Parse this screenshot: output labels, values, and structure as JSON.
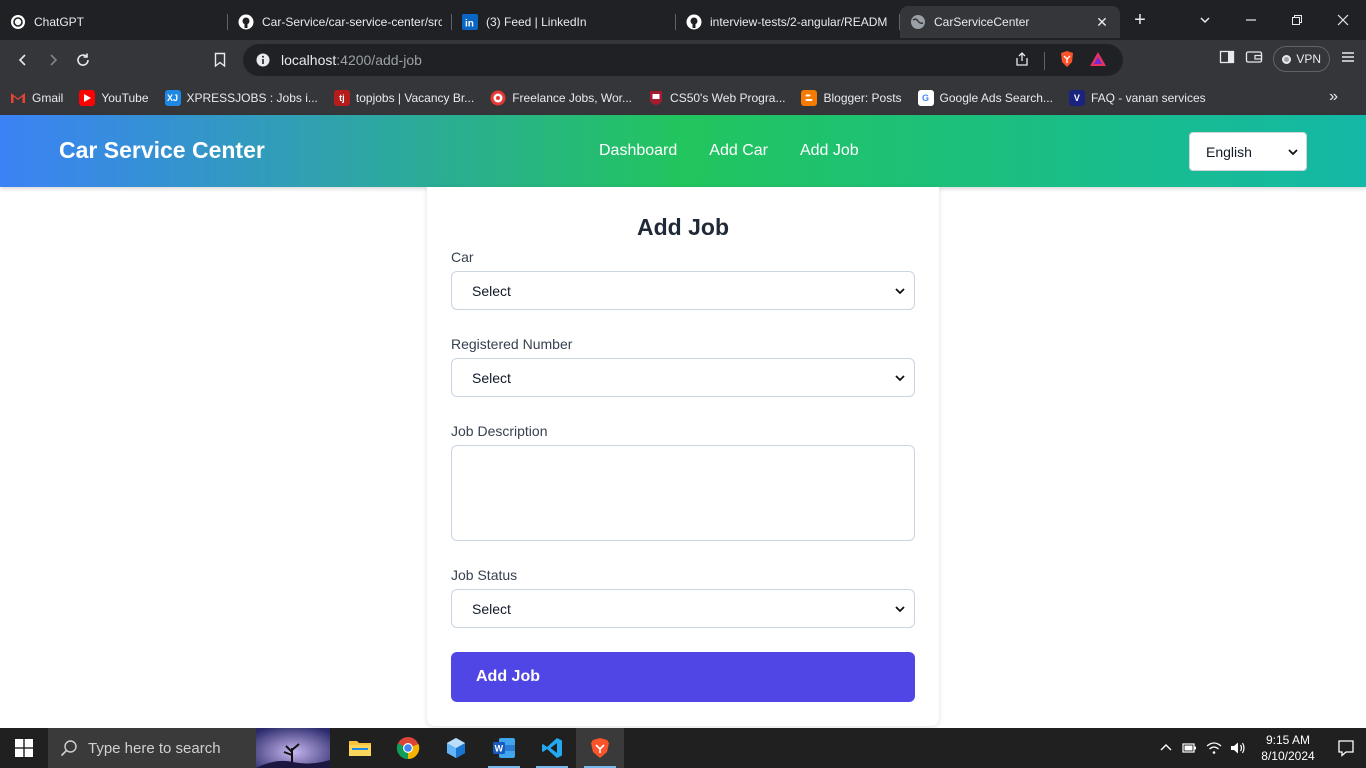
{
  "browser": {
    "tabs": [
      {
        "title": "ChatGPT",
        "icon": "openai-icon"
      },
      {
        "title": "Car-Service/car-service-center/src",
        "icon": "github-icon"
      },
      {
        "title": "(3) Feed | LinkedIn",
        "icon": "linkedin-icon"
      },
      {
        "title": "interview-tests/2-angular/READM",
        "icon": "github-icon"
      },
      {
        "title": "CarServiceCenter",
        "icon": "globe-icon",
        "active": true
      }
    ],
    "url_host": "localhost",
    "url_path": ":4200/add-job",
    "vpn_label": "VPN",
    "bookmarks": [
      {
        "label": "Gmail",
        "icon": "gmail-icon"
      },
      {
        "label": "YouTube",
        "icon": "youtube-icon"
      },
      {
        "label": "XPRESSJOBS : Jobs i...",
        "icon": "xj-icon",
        "icon_text": "XJ"
      },
      {
        "label": "topjobs | Vacancy Br...",
        "icon": "topjobs-icon",
        "icon_text": "tj"
      },
      {
        "label": "Freelance Jobs, Wor...",
        "icon": "freelance-icon"
      },
      {
        "label": "CS50's Web Progra...",
        "icon": "harvard-icon"
      },
      {
        "label": "Blogger: Posts",
        "icon": "blogger-icon"
      },
      {
        "label": "Google Ads Search...",
        "icon": "google-icon",
        "icon_text": "G"
      },
      {
        "label": "FAQ - vanan services",
        "icon": "vanan-icon",
        "icon_text": "V"
      }
    ]
  },
  "app": {
    "brand": "Car Service Center",
    "nav": [
      "Dashboard",
      "Add Car",
      "Add Job"
    ],
    "language": "English"
  },
  "form": {
    "title": "Add Job",
    "car_label": "Car",
    "car_value": "Select",
    "reg_label": "Registered Number",
    "reg_value": "Select",
    "desc_label": "Job Description",
    "desc_value": "",
    "status_label": "Job Status",
    "status_value": "Select",
    "submit_label": "Add Job"
  },
  "taskbar": {
    "search_placeholder": "Type here to search",
    "time": "9:15 AM",
    "date": "8/10/2024"
  },
  "colors": {
    "header_gradient": [
      "#3b82f6",
      "#22c55e",
      "#14b8a6"
    ],
    "primary_button": "#4f46e5"
  }
}
